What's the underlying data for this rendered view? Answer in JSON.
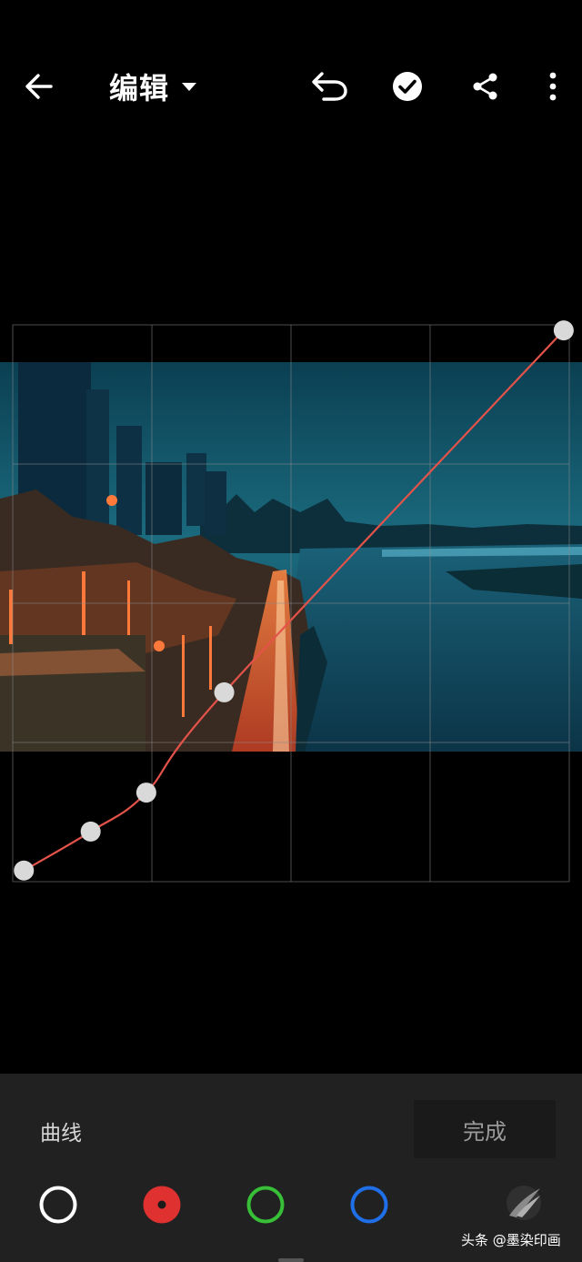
{
  "header": {
    "title": "编辑",
    "back_icon": "arrow-left-icon",
    "title_dropdown_icon": "caret-down-icon",
    "undo_icon": "undo-icon",
    "apply_icon": "check-circle-icon",
    "share_icon": "share-icon",
    "more_icon": "more-vertical-icon"
  },
  "editor": {
    "photo_description_icon": "photo",
    "curve": {
      "color": "#e4534a",
      "points": [
        {
          "x": 0.02,
          "y": 0.02
        },
        {
          "x": 0.14,
          "y": 0.09
        },
        {
          "x": 0.24,
          "y": 0.16
        },
        {
          "x": 0.38,
          "y": 0.34
        },
        {
          "x": 0.99,
          "y": 0.99
        }
      ]
    }
  },
  "panel": {
    "label": "曲线",
    "done_label": "完成",
    "channels": [
      {
        "name": "rgb",
        "color": "#ffffff"
      },
      {
        "name": "red",
        "color": "#e03131"
      },
      {
        "name": "green",
        "color": "#37c037"
      },
      {
        "name": "blue",
        "color": "#1f6fe8"
      }
    ],
    "watermark": "头条 @墨染印画"
  }
}
